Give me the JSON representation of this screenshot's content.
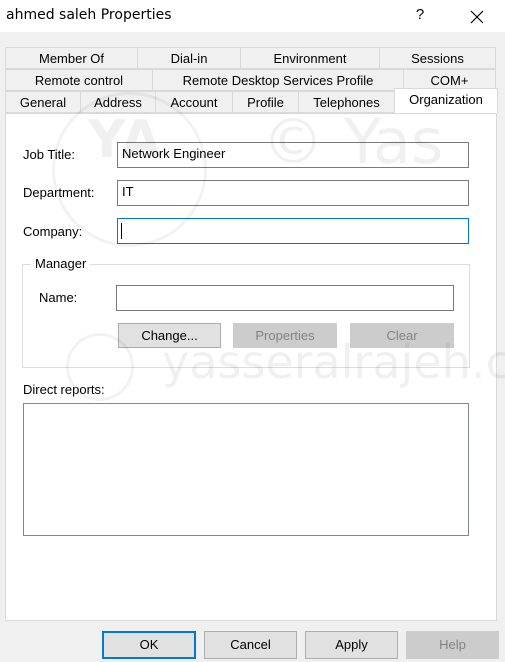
{
  "window": {
    "title": "ahmed saleh Properties",
    "help_label": "?",
    "close_icon": "close-icon"
  },
  "tabs": {
    "row1": [
      "Member Of",
      "Dial-in",
      "Environment",
      "Sessions"
    ],
    "row2": [
      "Remote control",
      "Remote Desktop Services Profile",
      "COM+"
    ],
    "row3": [
      "General",
      "Address",
      "Account",
      "Profile",
      "Telephones",
      "Organization"
    ],
    "active": "Organization"
  },
  "form": {
    "job_title_label": "Job Title:",
    "job_title_value": "Network Engineer",
    "department_label": "Department:",
    "department_value": "IT",
    "company_label": "Company:",
    "company_value": ""
  },
  "manager": {
    "group_label": "Manager",
    "name_label": "Name:",
    "name_value": "",
    "change_button": "Change...",
    "properties_button": "Properties",
    "clear_button": "Clear"
  },
  "direct_reports": {
    "label": "Direct reports:",
    "items": []
  },
  "footer": {
    "ok": "OK",
    "cancel": "Cancel",
    "apply": "Apply",
    "help": "Help"
  },
  "watermark": {
    "logo_text": "YA",
    "copyright_text": "© Yas",
    "site_text": "yasseralrajeh.c"
  }
}
